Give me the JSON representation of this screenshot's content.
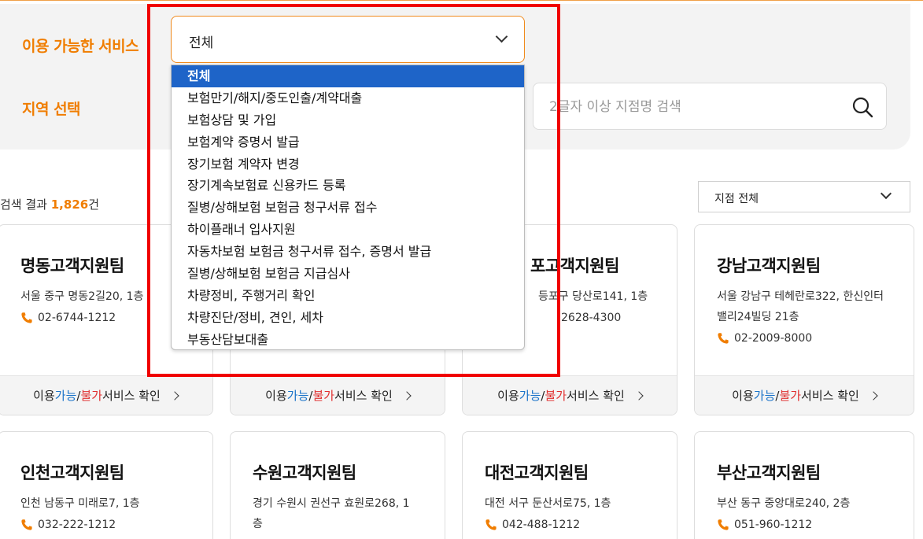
{
  "filter": {
    "service_label": "이용 가능한 서비스",
    "region_label": "지역 선택",
    "service_selected": "전체",
    "search_placeholder": "2글자 이상 지점명 검색"
  },
  "dropdown_options": [
    "전체",
    "보험만기/해지/중도인출/계약대출",
    "보험상담 및 가입",
    "보험계약 증명서 발급",
    "장기보험 계약자 변경",
    "장기계속보험료 신용카드 등록",
    "질병/상해보험 보험금 청구서류 접수",
    "하이플래너 입사지원",
    "자동차보험 보험금 청구서류 접수, 증명서 발급",
    "질병/상해보험 보험금 지급심사",
    "차량정비, 주행거리 확인",
    "차량진단/정비, 견인, 세차",
    "부동산담보대출"
  ],
  "results": {
    "prefix": "검색 결과 ",
    "count": "1,826",
    "suffix": "건"
  },
  "branch_filter": {
    "selected": "지점 전체"
  },
  "card_footer": {
    "pre": "이용 ",
    "avail": "가능",
    "sep": " / ",
    "unavail": "불가",
    "post": " 서비스 확인"
  },
  "cards": [
    {
      "name": "명동고객지원팀",
      "address": "서울 중구 명동2길20, 1층",
      "tel": "02-6744-1212"
    },
    {
      "name": "",
      "address": "",
      "tel": ""
    },
    {
      "name": "포고객지원팀",
      "address": "등포구 당산로141, 1층",
      "tel": "2628-4300"
    },
    {
      "name": "강남고객지원팀",
      "address": "서울 강남구 테헤란로322, 한신인터밸리24빌딩 21층",
      "tel": "02-2009-8000"
    },
    {
      "name": "인천고객지원팀",
      "address": "인천 남동구 미래로7, 1층",
      "tel": "032-222-1212"
    },
    {
      "name": "수원고객지원팀",
      "address": "경기 수원시 권선구 효원로268, 1층",
      "tel": ""
    },
    {
      "name": "대전고객지원팀",
      "address": "대전 서구 둔산서로75, 1층",
      "tel": "042-488-1212"
    },
    {
      "name": "부산고객지원팀",
      "address": "부산 동구 중앙대로240, 2층",
      "tel": "051-960-1212"
    }
  ],
  "colors": {
    "accent": "#f07d00",
    "available": "#1a73c9",
    "unavailable": "#e03030",
    "selected_option": "#1e64c8",
    "highlight_box": "#f00000"
  }
}
